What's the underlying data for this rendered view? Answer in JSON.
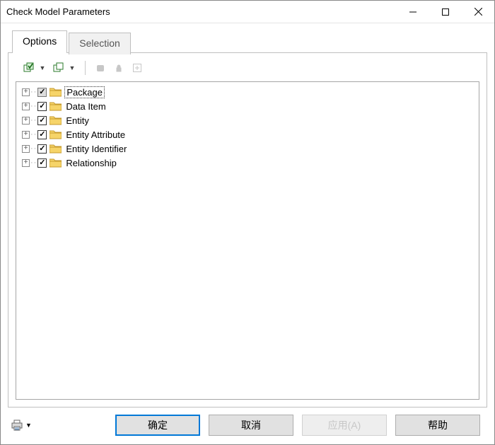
{
  "window": {
    "title": "Check Model Parameters"
  },
  "tabs": [
    {
      "label": "Options",
      "active": true
    },
    {
      "label": "Selection",
      "active": false
    }
  ],
  "toolbar_icons": [
    "select-all",
    "deselect-all",
    "sep",
    "filter-fill",
    "filter-outline",
    "add"
  ],
  "tree": [
    {
      "label": "Package",
      "checked": true,
      "mixed": true,
      "focused": true
    },
    {
      "label": "Data Item",
      "checked": true,
      "mixed": false,
      "focused": false
    },
    {
      "label": "Entity",
      "checked": true,
      "mixed": false,
      "focused": false
    },
    {
      "label": "Entity Attribute",
      "checked": true,
      "mixed": false,
      "focused": false
    },
    {
      "label": "Entity Identifier",
      "checked": true,
      "mixed": false,
      "focused": false
    },
    {
      "label": "Relationship",
      "checked": true,
      "mixed": false,
      "focused": false
    }
  ],
  "buttons": {
    "ok": "确定",
    "cancel": "取消",
    "apply": "应用(A)",
    "help": "帮助"
  }
}
